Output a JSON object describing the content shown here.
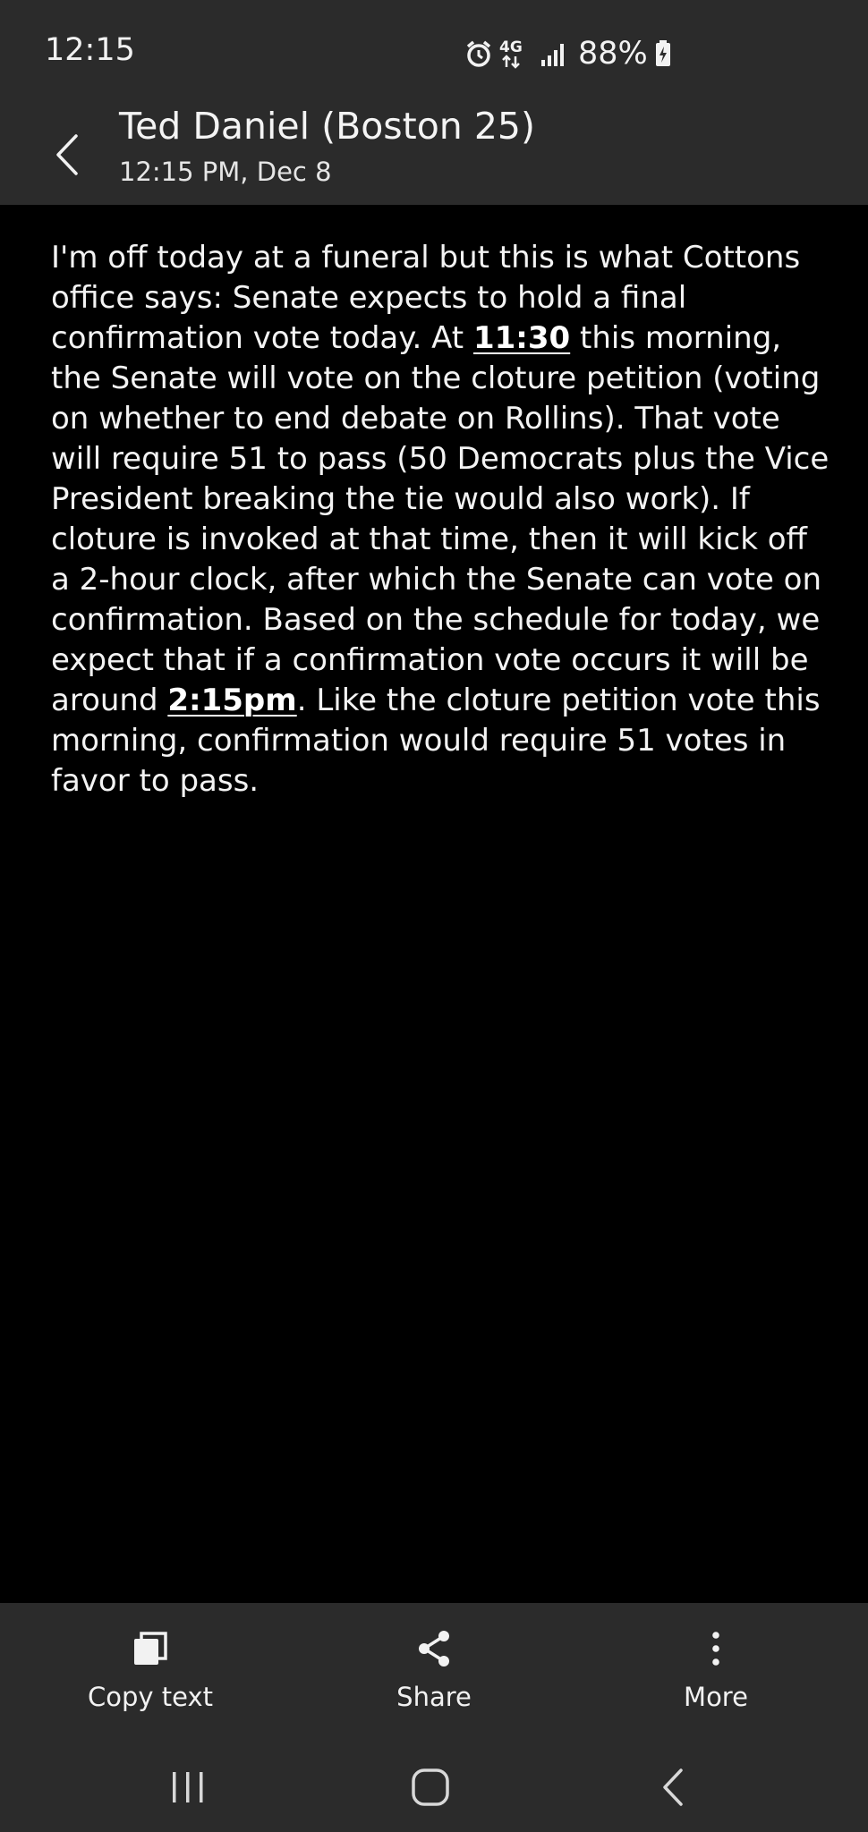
{
  "status_bar": {
    "time": "12:15",
    "network": "4G",
    "battery": "88%",
    "icons": [
      "alarm-icon",
      "network-4g-icon",
      "signal-icon",
      "battery-charging-icon"
    ]
  },
  "header": {
    "back_icon": "back-arrow-icon",
    "title": "Ted Daniel (Boston 25)",
    "subtitle": "12:15 PM, Dec 8"
  },
  "message": {
    "segments": [
      {
        "text": "I'm off today at a funeral but this is what Cottons office says: Senate expects to hold a final confirmation vote today. At ",
        "link": false
      },
      {
        "text": "11:30",
        "link": true
      },
      {
        "text": " this morning, the Senate will vote on the cloture petition (voting on whether to end debate on Rollins). That vote will require 51 to pass (50 Democrats plus the Vice President breaking the tie would also work). If cloture is invoked at that time, then it will kick off a 2-hour clock, after which the Senate can vote on confirmation. Based on the schedule for today, we expect that if a confirmation vote occurs it will be around ",
        "link": false
      },
      {
        "text": "2:15pm",
        "link": true
      },
      {
        "text": ". Like the cloture petition vote this morning, confirmation would require 51 votes in favor to pass.",
        "link": false
      }
    ]
  },
  "actions": [
    {
      "label": "Copy text",
      "icon": "copy-icon"
    },
    {
      "label": "Share",
      "icon": "share-icon"
    },
    {
      "label": "More",
      "icon": "more-vertical-icon"
    }
  ],
  "nav": {
    "recents_icon": "recents-icon",
    "home_icon": "home-icon",
    "back_icon": "nav-back-icon"
  },
  "colors": {
    "bar_background": "#2b2b2b",
    "page_background": "#000000",
    "text": "#f3f3f3"
  }
}
